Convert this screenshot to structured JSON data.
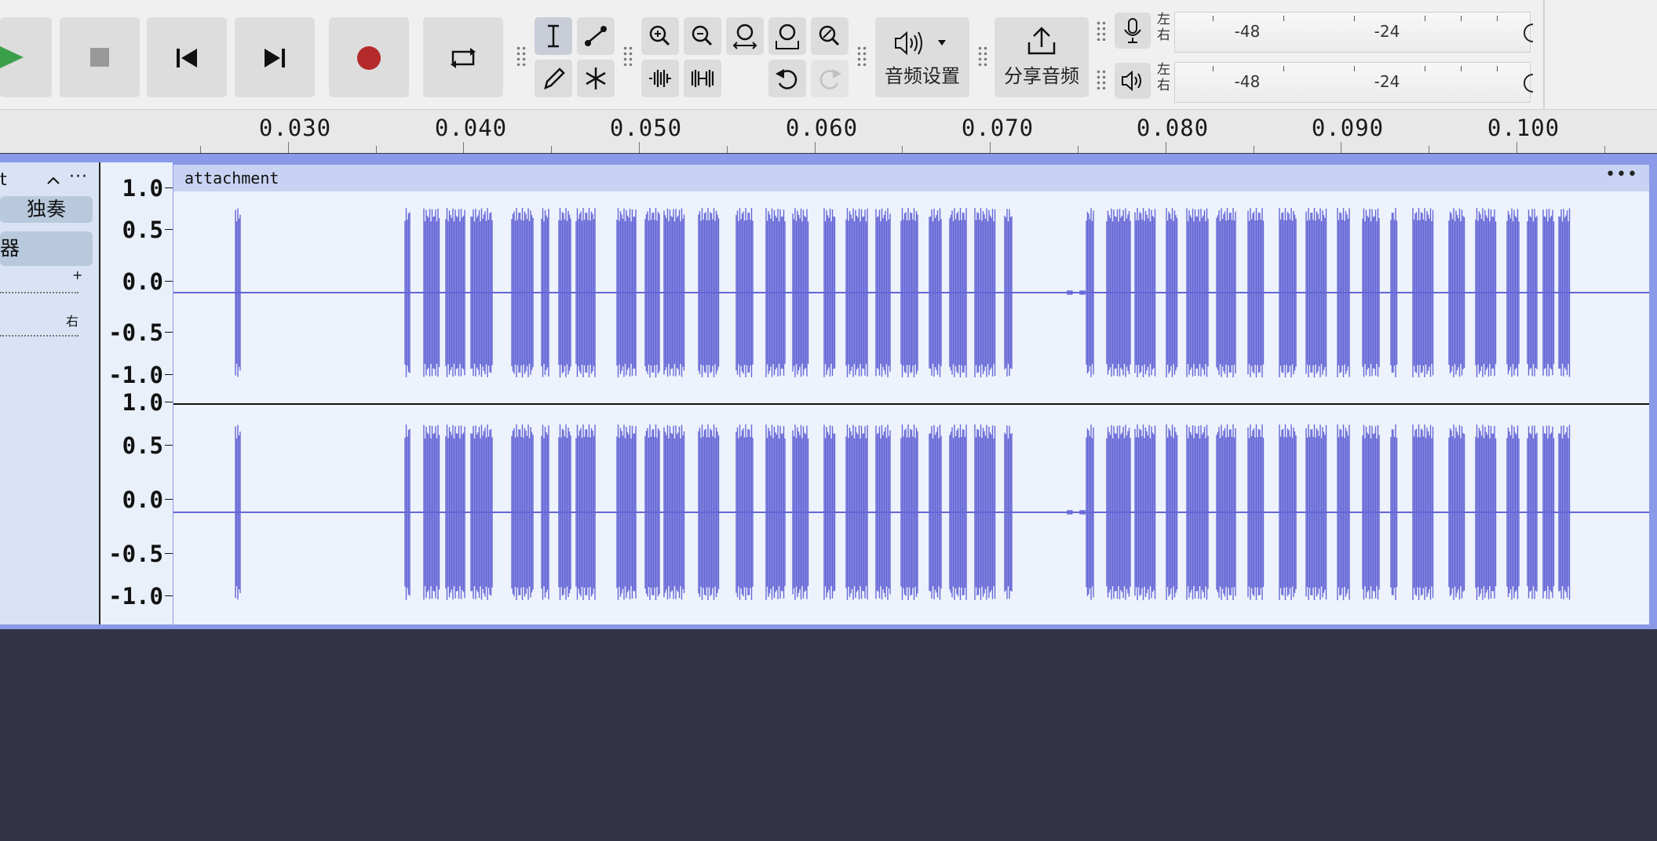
{
  "toolbar": {
    "play_label": "",
    "audio_settings_label": "音频设置",
    "share_audio_label": "分享音频"
  },
  "meters": {
    "record": {
      "left": "左",
      "right": "右",
      "labels": [
        "-48",
        "-24"
      ]
    },
    "playback": {
      "left": "左",
      "right": "右",
      "labels": [
        "-48",
        "-24"
      ]
    }
  },
  "ruler": {
    "labels": [
      "0.030",
      "0.040",
      "0.050",
      "0.060",
      "0.070",
      "0.080",
      "0.090",
      "0.100"
    ]
  },
  "track": {
    "name_fragment": "t",
    "solo_label": "独奏",
    "effects_fragment": "器",
    "gain_plus": "+",
    "pan_right": "右",
    "clip_name": "attachment",
    "clip_menu": "•••"
  },
  "vruler": {
    "labels": [
      "1.0",
      "0.5",
      "0.0",
      "-0.5",
      "-1.0"
    ]
  },
  "colors": {
    "waveform": "#6466d6",
    "record_button": "#b52a2a",
    "play_button": "#3aa14a",
    "background": "#323446",
    "clip_header": "#c8d2f2"
  },
  "icons": [
    "play-icon",
    "stop-icon",
    "skip-start-icon",
    "skip-end-icon",
    "record-icon",
    "loop-icon",
    "selection-tool-icon",
    "envelope-tool-icon",
    "draw-tool-icon",
    "multi-tool-icon",
    "zoom-in-icon",
    "zoom-out-icon",
    "fit-selection-icon",
    "fit-project-icon",
    "zoom-toggle-icon",
    "trim-icon",
    "silence-icon",
    "undo-icon",
    "redo-icon",
    "speaker-icon",
    "share-icon",
    "microphone-icon",
    "playback-speaker-icon"
  ]
}
